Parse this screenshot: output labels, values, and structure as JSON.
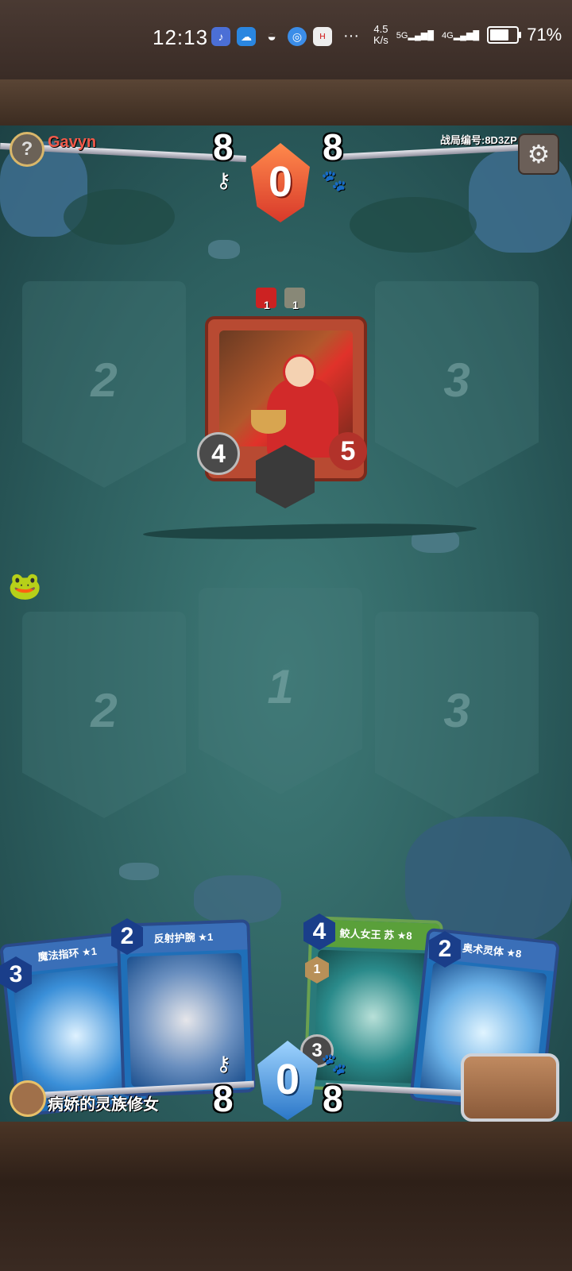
{
  "status_bar": {
    "time": "12:13",
    "apps": [
      "♪",
      "☁",
      "◒",
      "◎",
      "H"
    ],
    "dots": "···",
    "speed": "4.5\nK/s",
    "net1": "5G",
    "net2": "4G",
    "battery": "71%",
    "battery_level": 0.71
  },
  "opponent": {
    "avatar_glyph": "?",
    "name": "Gavyn",
    "left_value": "8",
    "right_value": "8",
    "mana": "0"
  },
  "match": {
    "id_label": "战局编号:8D3ZP"
  },
  "board": {
    "opponent_slots": [
      "2",
      "3"
    ],
    "player_slots": [
      "2",
      "1",
      "3"
    ],
    "played_card": {
      "buff_a": "1",
      "buff_b": "1",
      "attack": "4",
      "health": "5"
    }
  },
  "hand": [
    {
      "title": "魔法指环 ★1",
      "cost": "3"
    },
    {
      "title": "反射护腕 ★1",
      "cost": "2"
    },
    {
      "title": "鲛人女王 苏 ★8",
      "cost": "4",
      "tag": "1",
      "power": "3"
    },
    {
      "title": "奥术灵体 ★8",
      "cost": "2"
    }
  ],
  "player": {
    "name": "病娇的灵族修女",
    "left_value": "8",
    "right_value": "8",
    "mana": "0"
  },
  "icons": {
    "settings": "⚙",
    "key": "⚷",
    "paw": "🐾"
  }
}
